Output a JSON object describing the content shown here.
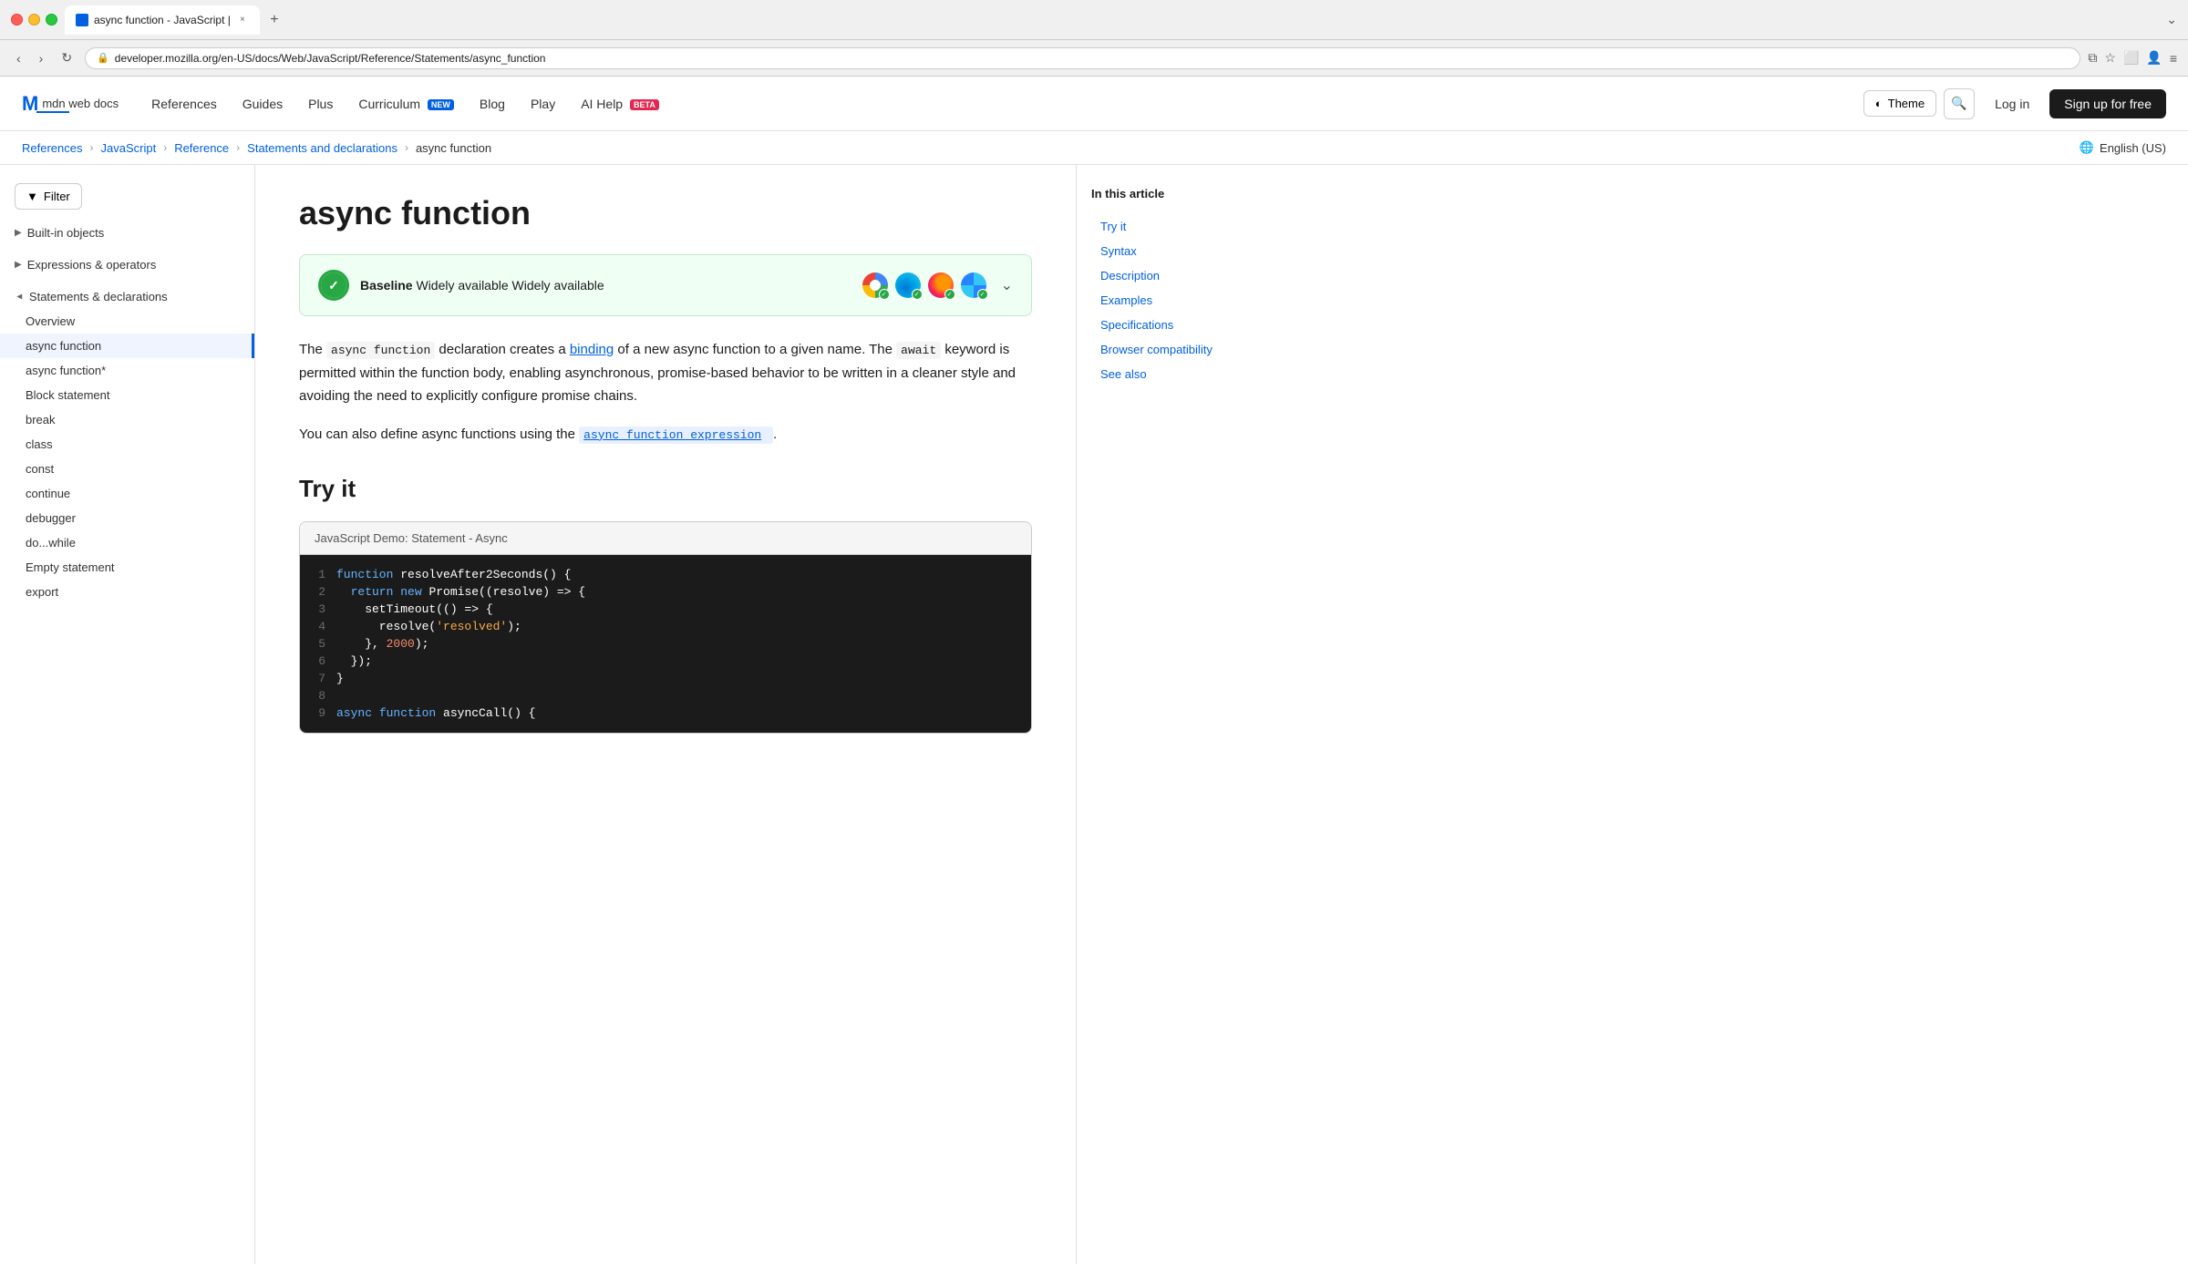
{
  "browser": {
    "tab_title": "async function - JavaScript |",
    "url": "developer.mozilla.org/en-US/docs/Web/JavaScript/Reference/Statements/async_function",
    "new_tab_label": "+"
  },
  "header": {
    "logo_m": "M",
    "logo_text": "mdn web docs",
    "nav_items": [
      {
        "label": "References",
        "badge": null
      },
      {
        "label": "Guides",
        "badge": null
      },
      {
        "label": "Plus",
        "badge": null
      },
      {
        "label": "Curriculum",
        "badge": "NEW",
        "badge_type": "new"
      },
      {
        "label": "Blog",
        "badge": null
      },
      {
        "label": "Play",
        "badge": null
      },
      {
        "label": "AI Help",
        "badge": "BETA",
        "badge_type": "beta"
      }
    ],
    "theme_label": "Theme",
    "login_label": "Log in",
    "signup_label": "Sign up for free"
  },
  "breadcrumb": {
    "items": [
      {
        "label": "References",
        "href": "#"
      },
      {
        "label": "JavaScript",
        "href": "#"
      },
      {
        "label": "Reference",
        "href": "#"
      },
      {
        "label": "Statements and declarations",
        "href": "#"
      },
      {
        "label": "async function",
        "href": "#"
      }
    ],
    "language": "English (US)"
  },
  "sidebar": {
    "filter_label": "Filter",
    "groups": [
      {
        "label": "Built-in objects",
        "expanded": false
      },
      {
        "label": "Expressions & operators",
        "expanded": false
      },
      {
        "label": "Statements & declarations",
        "expanded": true
      }
    ],
    "items": [
      {
        "label": "Overview",
        "active": false
      },
      {
        "label": "async function",
        "active": true
      },
      {
        "label": "async function*",
        "active": false
      },
      {
        "label": "Block statement",
        "active": false
      },
      {
        "label": "break",
        "active": false
      },
      {
        "label": "class",
        "active": false
      },
      {
        "label": "const",
        "active": false
      },
      {
        "label": "continue",
        "active": false
      },
      {
        "label": "debugger",
        "active": false
      },
      {
        "label": "do...while",
        "active": false
      },
      {
        "label": "Empty statement",
        "active": false
      },
      {
        "label": "export",
        "active": false
      }
    ]
  },
  "article": {
    "title": "async function",
    "baseline_label": "Baseline",
    "baseline_sublabel": "Widely available",
    "description_1": "The",
    "description_code_1": "async function",
    "description_2": "declaration creates a",
    "description_link": "binding",
    "description_3": "of a new async function to a given name. The",
    "description_code_2": "await",
    "description_4": "keyword is permitted within the function body, enabling asynchronous, promise-based behavior to be written in a cleaner style and avoiding the need to explicitly configure promise chains.",
    "description_5": "You can also define async functions using the",
    "description_link_2": "async function expression",
    "description_6": ".",
    "try_it_title": "Try it",
    "code_demo_header": "JavaScript Demo: Statement - Async",
    "code_lines": [
      {
        "num": 1,
        "parts": [
          {
            "text": "function",
            "class": "kw-blue"
          },
          {
            "text": " resolveAfter2Seconds() {",
            "class": "kw-white"
          }
        ]
      },
      {
        "num": 2,
        "parts": [
          {
            "text": "  return",
            "class": "kw-blue"
          },
          {
            "text": " ",
            "class": "kw-white"
          },
          {
            "text": "new",
            "class": "kw-blue"
          },
          {
            "text": " Promise((resolve) => {",
            "class": "kw-white"
          }
        ]
      },
      {
        "num": 3,
        "parts": [
          {
            "text": "    setTimeout(() => {",
            "class": "kw-white"
          }
        ]
      },
      {
        "num": 4,
        "parts": [
          {
            "text": "      resolve(",
            "class": "kw-white"
          },
          {
            "text": "'resolved'",
            "class": "kw-string"
          },
          {
            "text": ");",
            "class": "kw-white"
          }
        ]
      },
      {
        "num": 5,
        "parts": [
          {
            "text": "    }, ",
            "class": "kw-white"
          },
          {
            "text": "2000",
            "class": "kw-number"
          },
          {
            "text": ");",
            "class": "kw-white"
          }
        ]
      },
      {
        "num": 6,
        "parts": [
          {
            "text": "  });",
            "class": "kw-white"
          }
        ]
      },
      {
        "num": 7,
        "parts": [
          {
            "text": "}",
            "class": "kw-white"
          }
        ]
      },
      {
        "num": 8,
        "parts": [
          {
            "text": "",
            "class": "kw-white"
          }
        ]
      },
      {
        "num": 9,
        "parts": [
          {
            "text": "async",
            "class": "kw-blue"
          },
          {
            "text": " ",
            "class": "kw-white"
          },
          {
            "text": "function",
            "class": "kw-blue"
          },
          {
            "text": " asyncCall() {",
            "class": "kw-white"
          }
        ]
      }
    ]
  },
  "toc": {
    "title": "In this article",
    "items": [
      {
        "label": "Try it"
      },
      {
        "label": "Syntax"
      },
      {
        "label": "Description"
      },
      {
        "label": "Examples"
      },
      {
        "label": "Specifications"
      },
      {
        "label": "Browser compatibility"
      },
      {
        "label": "See also"
      }
    ]
  }
}
